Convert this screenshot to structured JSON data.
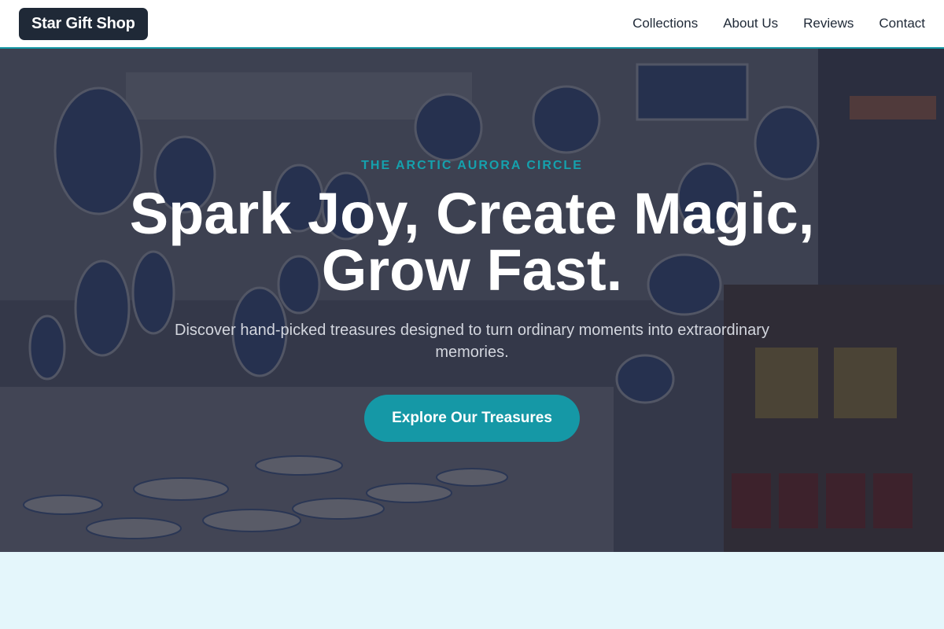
{
  "brand": {
    "name": "Star Gift Shop"
  },
  "nav": {
    "links": [
      "Collections",
      "About Us",
      "Reviews",
      "Contact"
    ]
  },
  "hero": {
    "eyebrow": "THE ARCTIC AURORA CIRCLE",
    "headline": "Spark Joy, Create Magic, Grow Fast.",
    "subtext": "Discover hand-picked treasures designed to turn ordinary moments into extraordinary memories.",
    "cta_label": "Explore Our Treasures",
    "background": "ceramic-shop-photo"
  },
  "colors": {
    "accent": "#1598a6",
    "brand_bg": "#1f2937",
    "section_bg": "#e4f6fb"
  }
}
